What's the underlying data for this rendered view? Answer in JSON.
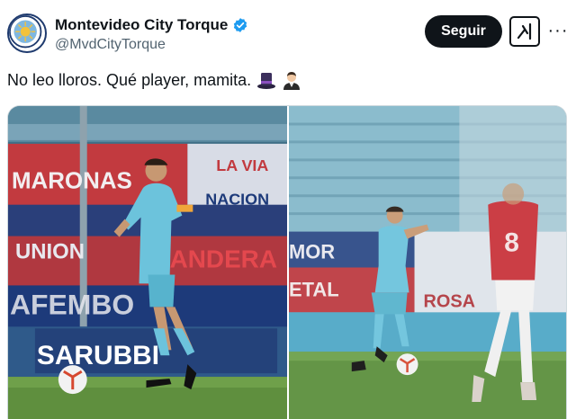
{
  "tweet": {
    "display_name": "Montevideo City Torque",
    "handle": "@MvdCityTorque",
    "follow_label": "Seguir",
    "more_label": "···",
    "text": "No leo lloros. Qué player, mamita.",
    "emojis": [
      "top-hat-emoji",
      "man-in-tuxedo-emoji"
    ],
    "verified": true
  },
  "media": {
    "left_photo": {
      "banner_texts": [
        "MARONAS",
        "LA VIA",
        "NACION",
        "UNION",
        "BANDERA",
        "AFEMBO",
        "SARUBBI"
      ]
    },
    "right_photo": {
      "banner_texts": [
        "MOR",
        "ETAL",
        "ROSA",
        "8"
      ]
    }
  },
  "colors": {
    "accent": "#1d9bf0",
    "text": "#0f1419",
    "muted": "#536471",
    "kit": "#6cc3dc",
    "pitch": "#4b8a3a"
  }
}
